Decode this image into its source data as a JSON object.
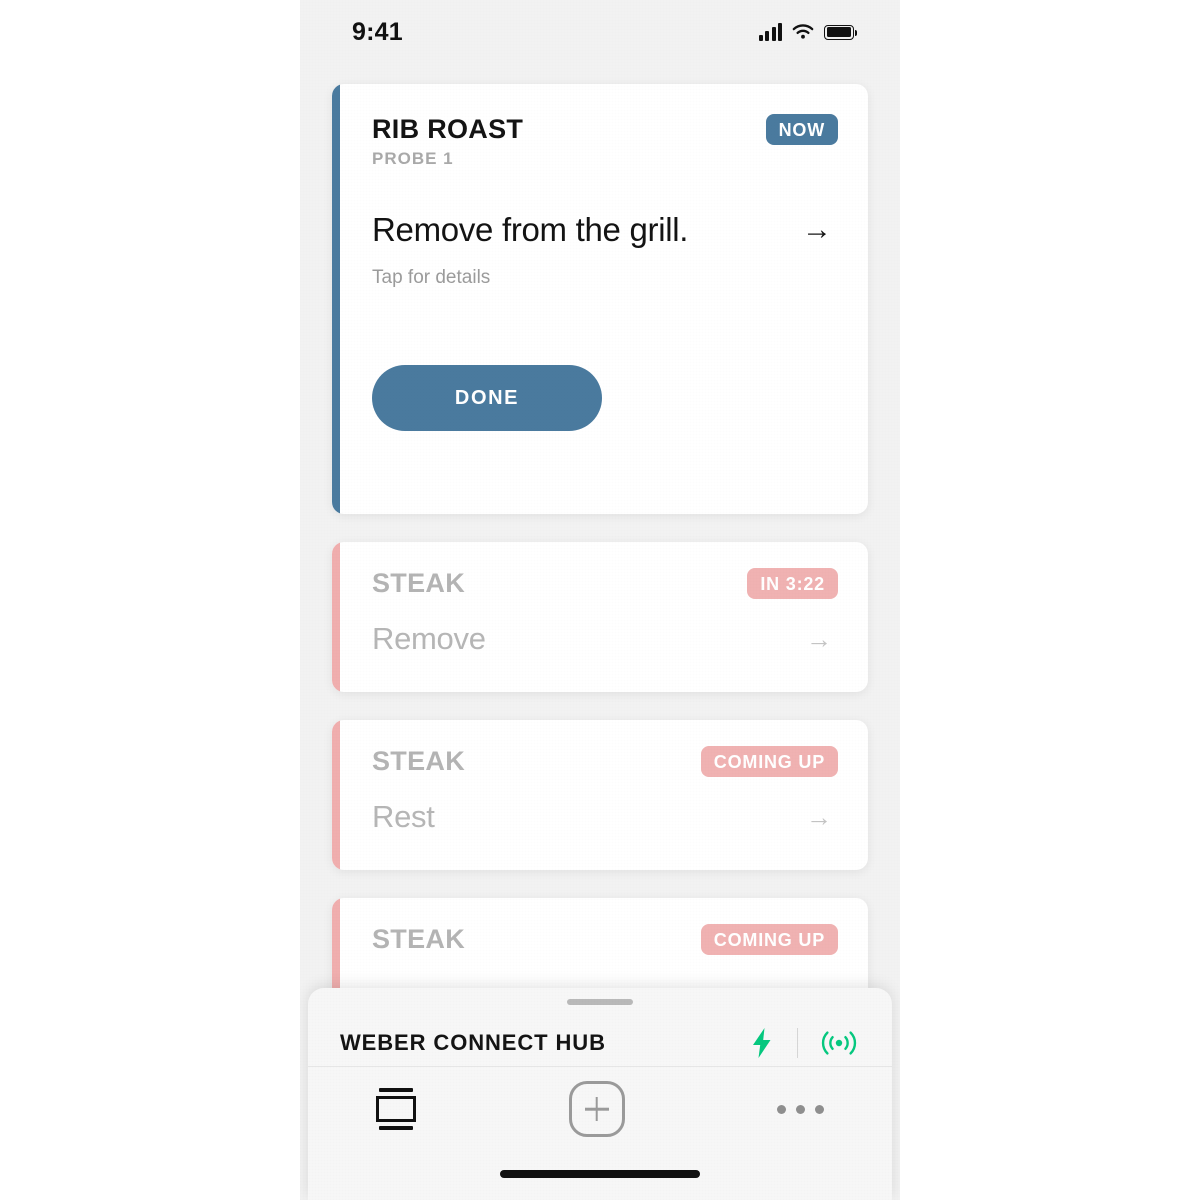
{
  "status_bar": {
    "time": "9:41",
    "signal_icon": "cellular-bars-icon",
    "wifi_icon": "wifi-icon",
    "battery_icon": "battery-full-icon"
  },
  "theme": {
    "accent_blue": "#4a7a9e",
    "accent_pink": "#f0aeae",
    "badge_pink": "#f0b2b2",
    "green": "#05c87f",
    "background": "#f2f2f2",
    "card_background": "#ffffff"
  },
  "cards": [
    {
      "meat": "RIB ROAST",
      "probe": "PROBE 1",
      "badge": "NOW",
      "badge_style": "blue",
      "action": "Remove from the grill.",
      "hint": "Tap for details",
      "arrow": "→",
      "button_label": "DONE",
      "accent": "#4a7a9e",
      "state": "active"
    },
    {
      "meat": "STEAK",
      "badge": "IN 3:22",
      "badge_style": "pink",
      "action": "Remove",
      "arrow": "→",
      "accent": "#f0aeae",
      "state": "upcoming"
    },
    {
      "meat": "STEAK",
      "badge": "COMING UP",
      "badge_style": "pink",
      "action": "Rest",
      "arrow": "→",
      "accent": "#f0aeae",
      "state": "upcoming"
    },
    {
      "meat": "STEAK",
      "badge": "COMING UP",
      "badge_style": "pink",
      "action": "",
      "arrow": "→",
      "accent": "#f0aeae",
      "state": "upcoming-clipped"
    }
  ],
  "sheet": {
    "grab_handle": "sheet-grab-handle",
    "hub_name": "WEBER CONNECT HUB",
    "power_icon": "lightning-bolt-icon",
    "signal_icon": "wireless-broadcast-icon"
  },
  "tabbar": {
    "grill_tab": "grill-icon",
    "add_button": "plus-icon",
    "more_button": "more-dots-icon"
  }
}
